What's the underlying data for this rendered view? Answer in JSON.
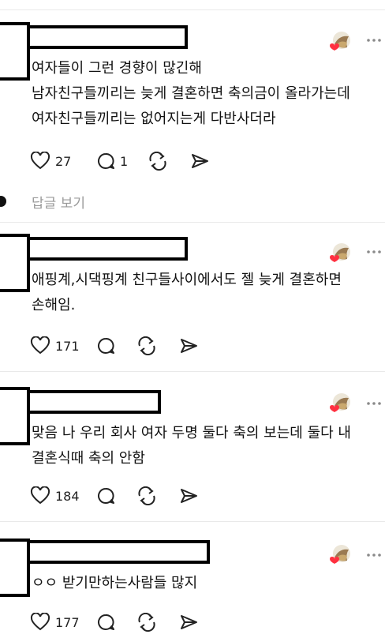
{
  "reply_link": {
    "label": "답글 보기"
  },
  "comments": [
    {
      "lines": [
        "여자들이 그런 경향이 많긴해",
        "남자친구들끼리는 늦게 결혼하면 축의금이 올라가는데",
        "여자친구들끼리는 없어지는게 다반사더라"
      ],
      "likes": "27",
      "replies": "1"
    },
    {
      "lines": [
        "애핑계,시댁핑계 친구들사이에서도 젤 늦게 결혼하면",
        "손해임."
      ],
      "likes": "171",
      "replies": ""
    },
    {
      "lines": [
        "맞음 나 우리 회사 여자 두명 둘다 축의 보는데 둘다 내",
        "결혼식때 축의 안함"
      ],
      "likes": "184",
      "replies": ""
    },
    {
      "lines": [
        "ㅇㅇ 받기만하는사람들 많지"
      ],
      "likes": "177",
      "replies": ""
    }
  ],
  "icons": [
    "heart-icon",
    "comment-icon",
    "repost-icon",
    "share-icon",
    "more-icon"
  ],
  "colors": {
    "text": "#111111",
    "muted": "#9a9a9a",
    "divider": "#e9e9e9",
    "redaction": "#000000"
  }
}
